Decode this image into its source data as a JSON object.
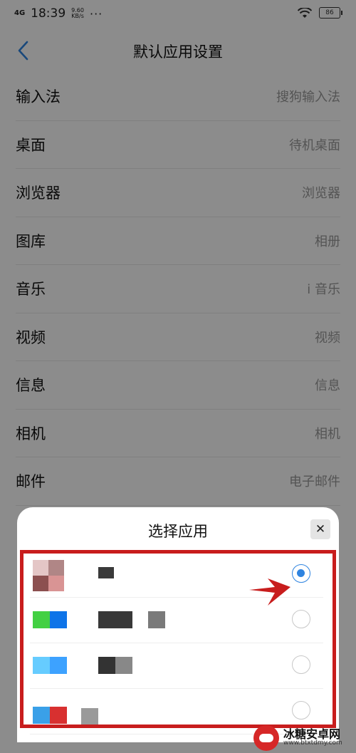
{
  "status_bar": {
    "signal": "4G",
    "time": "18:39",
    "speed_value": "9.60",
    "speed_unit": "KB/s",
    "more": "···",
    "battery": "86"
  },
  "header": {
    "title": "默认应用设置",
    "back_icon": "chevron-left-icon"
  },
  "settings": [
    {
      "label": "输入法",
      "value": "搜狗输入法"
    },
    {
      "label": "桌面",
      "value": "待机桌面"
    },
    {
      "label": "浏览器",
      "value": "浏览器"
    },
    {
      "label": "图库",
      "value": "相册"
    },
    {
      "label": "音乐",
      "value": "i 音乐"
    },
    {
      "label": "视频",
      "value": "视频"
    },
    {
      "label": "信息",
      "value": "信息"
    },
    {
      "label": "相机",
      "value": "相机"
    },
    {
      "label": "邮件",
      "value": "电子邮件"
    }
  ],
  "dialog": {
    "title": "选择应用",
    "close_label": "✕",
    "options": [
      {
        "selected": true
      },
      {
        "selected": false
      },
      {
        "selected": false
      },
      {
        "selected": false
      }
    ]
  },
  "colors": {
    "accent": "#2f84e0",
    "highlight": "#c81d1d"
  },
  "watermark": {
    "name": "冰糖安卓网",
    "url": "www.btxtdmy.com"
  }
}
